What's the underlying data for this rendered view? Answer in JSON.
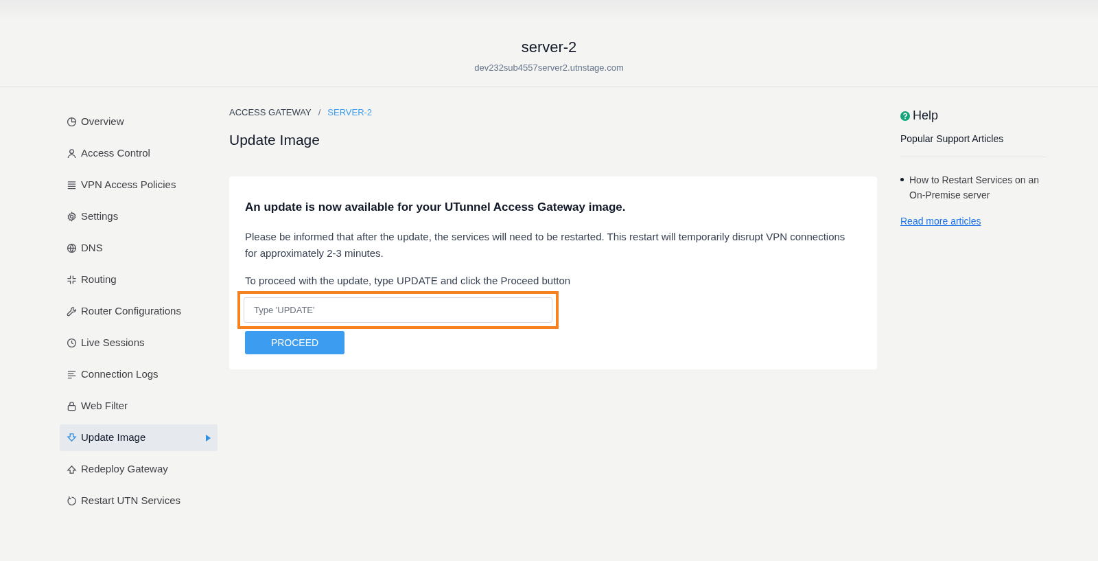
{
  "header": {
    "title": "server-2",
    "subtitle": "dev232sub4557server2.utnstage.com"
  },
  "sidebar": {
    "items": [
      {
        "label": "Overview",
        "selected": false
      },
      {
        "label": "Access Control",
        "selected": false
      },
      {
        "label": "VPN Access Policies",
        "selected": false
      },
      {
        "label": "Settings",
        "selected": false
      },
      {
        "label": "DNS",
        "selected": false
      },
      {
        "label": "Routing",
        "selected": false
      },
      {
        "label": "Router Configurations",
        "selected": false
      },
      {
        "label": "Live Sessions",
        "selected": false
      },
      {
        "label": "Connection Logs",
        "selected": false
      },
      {
        "label": "Web Filter",
        "selected": false
      },
      {
        "label": "Update Image",
        "selected": true
      },
      {
        "label": "Redeploy Gateway",
        "selected": false
      },
      {
        "label": "Restart UTN Services",
        "selected": false
      }
    ]
  },
  "breadcrumb": [
    {
      "label": "ACCESS GATEWAY",
      "current": false
    },
    {
      "label": "SERVER-2",
      "current": true
    }
  ],
  "breadcrumb_separator": "/",
  "page_title": "Update Image",
  "card": {
    "heading": "An update is now available for your UTunnel Access Gateway image.",
    "message": "Please be informed that after the update, the services will need to be restarted. This restart will temporarily disrupt VPN connections for approximately 2-3 minutes.",
    "instruction": "To proceed with the update, type UPDATE and click the Proceed button",
    "field": {
      "placeholder": "Type 'UPDATE'",
      "highlighted": true
    },
    "button": "PROCEED"
  },
  "help": {
    "title": "Help",
    "subtitle": "Popular Support Articles",
    "articles": [
      "How to Restart Services on an On-Premise server"
    ],
    "link": "Read more articles"
  }
}
